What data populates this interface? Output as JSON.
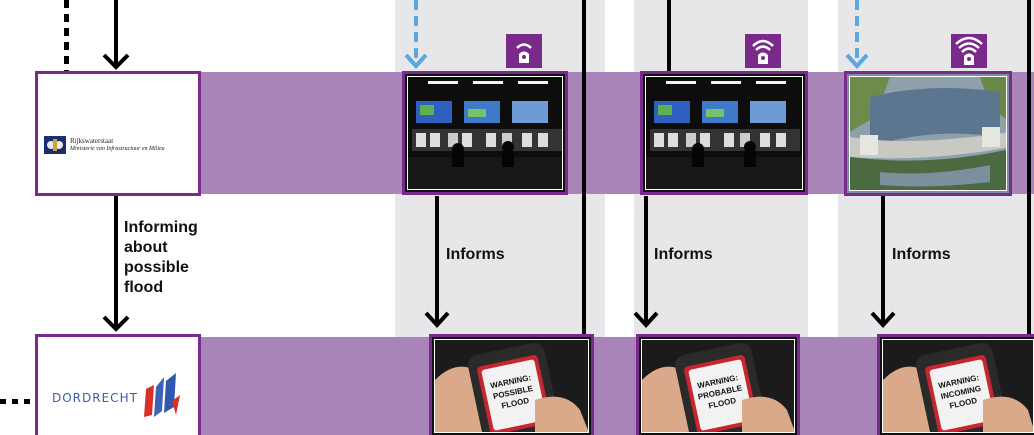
{
  "diagram": {
    "labels": {
      "informing": [
        "Informing",
        "about",
        "possible",
        "flood"
      ],
      "informs": [
        "Informs",
        "Informs",
        "Informs"
      ]
    },
    "rijkswaterstaat": {
      "name": "Rijkswaterstaat",
      "ministry": "Ministerie van Infrastructuur en Milieu"
    },
    "dordrecht": {
      "name": "DORDRECHT"
    },
    "phones": [
      {
        "line1": "WARNING:",
        "line2": "POSSIBLE",
        "line3": "FLOOD"
      },
      {
        "line1": "WARNING:",
        "line2": "PROBABLE",
        "line3": "FLOOD"
      },
      {
        "line1": "WARNING:",
        "line2": "INCOMING",
        "line3": "FLOOD"
      }
    ],
    "colors": {
      "band": "#a884b8",
      "border": "#7a2a8a",
      "column_bg": "#e7e7e9",
      "dashed_arrow": "#5aa8e0"
    },
    "icons": [
      "sensor-icon",
      "control-room-photo",
      "flood-barrier-photo",
      "phone-warning-photo",
      "government-logo",
      "dordrecht-logo"
    ]
  }
}
